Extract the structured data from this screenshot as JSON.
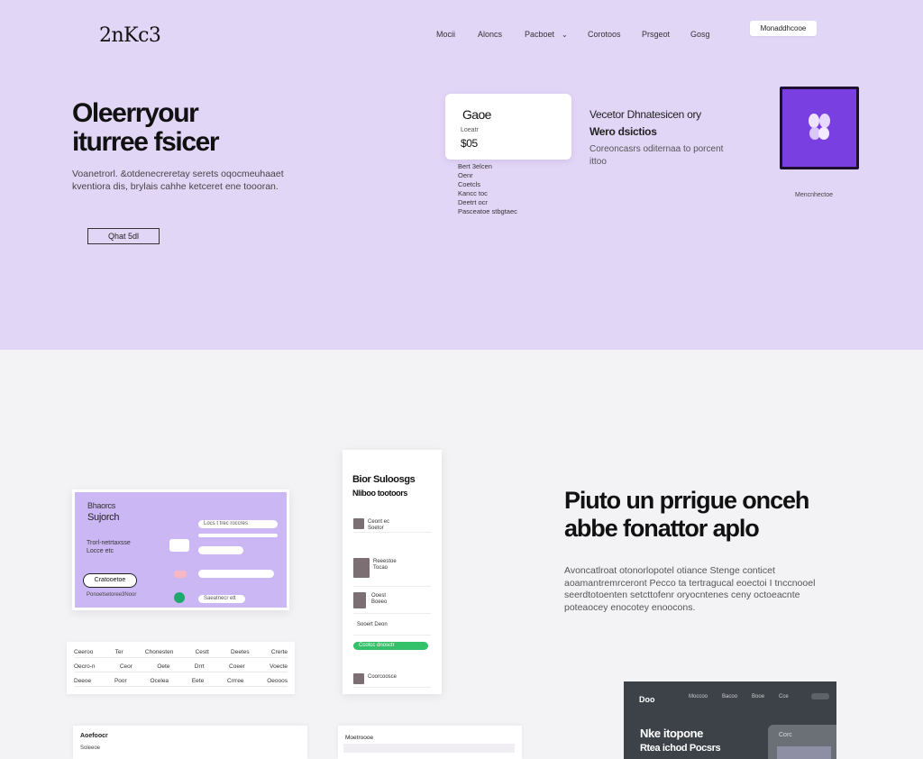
{
  "brand": {
    "logo": "2nKc3"
  },
  "nav": {
    "items": [
      "Mocii",
      "Aloncs",
      "Pacboet",
      "Corotoos",
      "Prsgeot",
      "Gosg"
    ],
    "dropdown_icon": "chevron-down-icon",
    "cta": "Monaddhcooe"
  },
  "hero": {
    "title_line1": "Oleerryour",
    "title_line2": "iturree fsicer",
    "subtitle": "Voanetrorl. &otdenecreretay serets oqocmeuhaaet kventiora dis, brylais cahhe ketceret ene toooran.",
    "button": "Qhat 5dl"
  },
  "plan": {
    "name": "Gaoe",
    "label": "Loeatr",
    "price": "$05",
    "list": [
      "Bert 3elcen",
      "Oenr",
      "Coetcls",
      "Kancc toc",
      "Deetrt ocr",
      "Pasceatoe stbgtaec"
    ]
  },
  "feature": {
    "title_line1": "Vecetor Dhnatesicen ory",
    "title_line2": "Wero dsictios",
    "subtitle": "Coreoncasrs oditernaa to porcent ittoo"
  },
  "promo": {
    "caption": "Mencnhectoe",
    "icon": "hands-icon",
    "color": "#7a3fe0"
  },
  "mock_form": {
    "title": "Bhaorcs",
    "subtitle": "Sujorch",
    "labels": [
      "Trorl-netrtaxsse",
      "Locce etc"
    ],
    "fields": [
      "Locs t trec roccres",
      "Saeatnecr ett"
    ],
    "pill": "Cratooetoe",
    "footer": "Ponoetsetoree3Noor"
  },
  "mock_table": {
    "rows": [
      [
        "Ceeroo",
        "Ter",
        "Chonesten",
        "Cestt",
        "Deetes",
        "Crerte"
      ],
      [
        "Oecro-n",
        "Ceor",
        "Oete",
        "Drrt",
        "Coeer",
        "Voecte"
      ],
      [
        "Deeoe",
        "Poor",
        "Ocelea",
        "Eete",
        "Crrree",
        "Oeooos"
      ]
    ]
  },
  "mock_phone": {
    "title_line1": "Bior Suloosgs",
    "title_line2": "Nliboo tootoors",
    "rows": [
      [
        "Ceont ec",
        "Soetor"
      ],
      [
        "Reeestoe",
        "Tocao"
      ],
      [
        "Ooest",
        "Boeeo"
      ],
      [
        "Sooert",
        "Deon"
      ]
    ],
    "green_button": "Ccotcc dnosctr",
    "footer": "Coorcoosce"
  },
  "section": {
    "title_line1": "Piuto un prrigue onceh",
    "title_line2": "abbe fonattor aplo",
    "body": "Avoncatlroat otonorlopotel otiance Stenge conticet aoamantremrceront Pecco ta tertragucal eoectoi I tnccnooel seerdtotoenten setcttofenr oryocntenes ceny octoeacnte poteaocey enocotey enoocons."
  },
  "dark_card": {
    "brand": "Doo",
    "nav": [
      "Moccoo",
      "Bacoo",
      "Booe",
      "Cce"
    ],
    "title_line1": "Nke itopone",
    "title_line2": "Rtea ichod Pocsrs",
    "panel_label": "Corc"
  },
  "bottom_cards": {
    "card1_title": "Aoefoocr",
    "card1_sub": "Soleeoe",
    "card2_title": "Moetroooe"
  },
  "colors": {
    "hero_bg": "#e2d6f7",
    "accent": "#7a3fe0",
    "green": "#33c26a"
  }
}
